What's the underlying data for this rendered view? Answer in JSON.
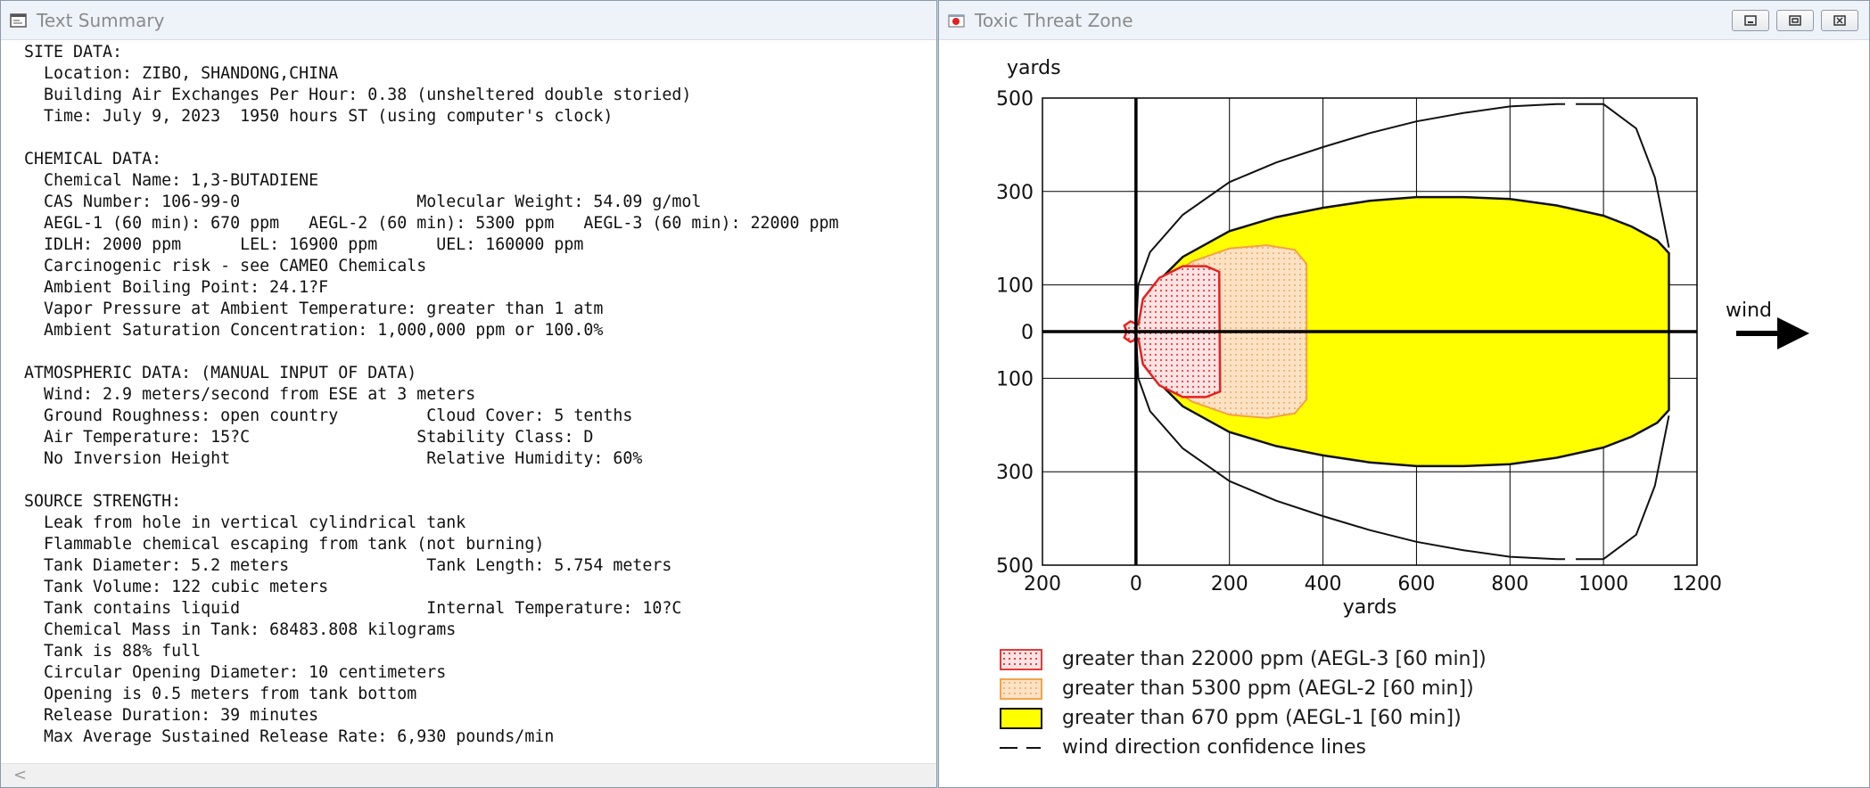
{
  "text_window": {
    "title": "Text Summary",
    "lines": [
      "SITE DATA:",
      "  Location: ZIBO, SHANDONG,CHINA",
      "  Building Air Exchanges Per Hour: 0.38 (unsheltered double storied)",
      "  Time: July 9, 2023  1950 hours ST (using computer's clock)",
      "",
      "CHEMICAL DATA:",
      "  Chemical Name: 1,3-BUTADIENE",
      "  CAS Number: 106-99-0                  Molecular Weight: 54.09 g/mol",
      "  AEGL-1 (60 min): 670 ppm   AEGL-2 (60 min): 5300 ppm   AEGL-3 (60 min): 22000 ppm",
      "  IDLH: 2000 ppm      LEL: 16900 ppm      UEL: 160000 ppm",
      "  Carcinogenic risk - see CAMEO Chemicals",
      "  Ambient Boiling Point: 24.1?F",
      "  Vapor Pressure at Ambient Temperature: greater than 1 atm",
      "  Ambient Saturation Concentration: 1,000,000 ppm or 100.0%",
      "",
      "ATMOSPHERIC DATA: (MANUAL INPUT OF DATA)",
      "  Wind: 2.9 meters/second from ESE at 3 meters",
      "  Ground Roughness: open country         Cloud Cover: 5 tenths",
      "  Air Temperature: 15?C                 Stability Class: D",
      "  No Inversion Height                    Relative Humidity: 60%",
      "",
      "SOURCE STRENGTH:",
      "  Leak from hole in vertical cylindrical tank",
      "  Flammable chemical escaping from tank (not burning)",
      "  Tank Diameter: 5.2 meters              Tank Length: 5.754 meters",
      "  Tank Volume: 122 cubic meters",
      "  Tank contains liquid                   Internal Temperature: 10?C",
      "  Chemical Mass in Tank: 68483.808 kilograms",
      "  Tank is 88% full",
      "  Circular Opening Diameter: 10 centimeters",
      "  Opening is 0.5 meters from tank bottom",
      "  Release Duration: 39 minutes",
      "  Max Average Sustained Release Rate: 6,930 pounds/min"
    ],
    "scroll_left": "<"
  },
  "threat_window": {
    "title": "Toxic Threat Zone",
    "controls": {
      "minimize": "–",
      "maximize": "□",
      "close": "✕"
    },
    "colors": {
      "aegl1": "#ffff00",
      "aegl2": "#f5a142",
      "aegl3": "#e62020"
    },
    "legend": [
      {
        "id": "aegl3",
        "label": "greater than 22000 ppm (AEGL-3 [60 min])"
      },
      {
        "id": "aegl2",
        "label": "greater than 5300 ppm (AEGL-2 [60 min])"
      },
      {
        "id": "aegl1",
        "label": "greater than 670 ppm (AEGL-1 [60 min])"
      },
      {
        "id": "conf",
        "label": "wind direction confidence lines"
      }
    ]
  },
  "chart_data": {
    "type": "threat-zone",
    "xlabel": "yards",
    "ylabel": "yards",
    "wind_label": "wind",
    "xlim": [
      -200,
      1200
    ],
    "ylim": [
      -500,
      500
    ],
    "x_ticks": [
      -200,
      0,
      200,
      400,
      600,
      800,
      1000,
      1200
    ],
    "x_tick_labels": [
      "200",
      "0",
      "200",
      "400",
      "600",
      "800",
      "1000",
      "1200"
    ],
    "y_ticks": [
      500,
      300,
      100,
      0,
      -100,
      -300,
      -500
    ],
    "y_tick_labels": [
      "500",
      "300",
      "100",
      "0",
      "100",
      "300",
      "500"
    ],
    "grid": true,
    "zones": [
      {
        "id": "aegl1",
        "max_x": 1140,
        "upper": [
          [
            0,
            0
          ],
          [
            20,
            60
          ],
          [
            60,
            120
          ],
          [
            100,
            160
          ],
          [
            200,
            215
          ],
          [
            300,
            245
          ],
          [
            400,
            265
          ],
          [
            500,
            280
          ],
          [
            600,
            288
          ],
          [
            700,
            288
          ],
          [
            800,
            284
          ],
          [
            900,
            270
          ],
          [
            1000,
            248
          ],
          [
            1060,
            225
          ],
          [
            1115,
            195
          ],
          [
            1140,
            168
          ],
          [
            1140,
            -168
          ],
          [
            1115,
            -195
          ],
          [
            1060,
            -225
          ],
          [
            1000,
            -248
          ],
          [
            900,
            -270
          ],
          [
            800,
            -284
          ],
          [
            700,
            -288
          ],
          [
            600,
            -288
          ],
          [
            500,
            -280
          ],
          [
            400,
            -265
          ],
          [
            300,
            -245
          ],
          [
            200,
            -215
          ],
          [
            100,
            -160
          ],
          [
            60,
            -120
          ],
          [
            20,
            -60
          ]
        ]
      },
      {
        "id": "aegl2",
        "max_x": 365,
        "upper": [
          [
            0,
            0
          ],
          [
            20,
            50
          ],
          [
            60,
            110
          ],
          [
            120,
            150
          ],
          [
            200,
            178
          ],
          [
            280,
            185
          ],
          [
            340,
            175
          ],
          [
            365,
            145
          ],
          [
            365,
            -145
          ],
          [
            340,
            -175
          ],
          [
            280,
            -185
          ],
          [
            200,
            -178
          ],
          [
            120,
            -150
          ],
          [
            60,
            -110
          ],
          [
            20,
            -50
          ]
        ]
      },
      {
        "id": "aegl3",
        "max_x": 180,
        "upper": [
          [
            -20,
            0
          ],
          [
            -25,
            13
          ],
          [
            -12,
            22
          ],
          [
            5,
            15
          ],
          [
            15,
            70
          ],
          [
            50,
            115
          ],
          [
            100,
            140
          ],
          [
            150,
            140
          ],
          [
            178,
            128
          ],
          [
            180,
            -128
          ],
          [
            150,
            -140
          ],
          [
            100,
            -140
          ],
          [
            50,
            -115
          ],
          [
            15,
            -70
          ],
          [
            5,
            -15
          ],
          [
            -12,
            -22
          ],
          [
            -25,
            -13
          ]
        ]
      }
    ],
    "confidence_upper": [
      [
        0,
        0
      ],
      [
        5,
        100
      ],
      [
        30,
        170
      ],
      [
        100,
        250
      ],
      [
        200,
        320
      ],
      [
        300,
        362
      ],
      [
        400,
        395
      ],
      [
        500,
        425
      ],
      [
        600,
        450
      ],
      [
        700,
        468
      ],
      [
        800,
        482
      ],
      [
        900,
        487
      ],
      [
        1000,
        487
      ],
      [
        1070,
        435
      ],
      [
        1110,
        330
      ],
      [
        1140,
        180
      ]
    ],
    "confidence_lower": [
      [
        0,
        0
      ],
      [
        5,
        -100
      ],
      [
        30,
        -170
      ],
      [
        100,
        -250
      ],
      [
        200,
        -320
      ],
      [
        300,
        -362
      ],
      [
        400,
        -395
      ],
      [
        500,
        -425
      ],
      [
        600,
        -450
      ],
      [
        700,
        -468
      ],
      [
        800,
        -482
      ],
      [
        900,
        -487
      ],
      [
        1000,
        -487
      ],
      [
        1070,
        -435
      ],
      [
        1110,
        -330
      ],
      [
        1140,
        -180
      ]
    ]
  }
}
